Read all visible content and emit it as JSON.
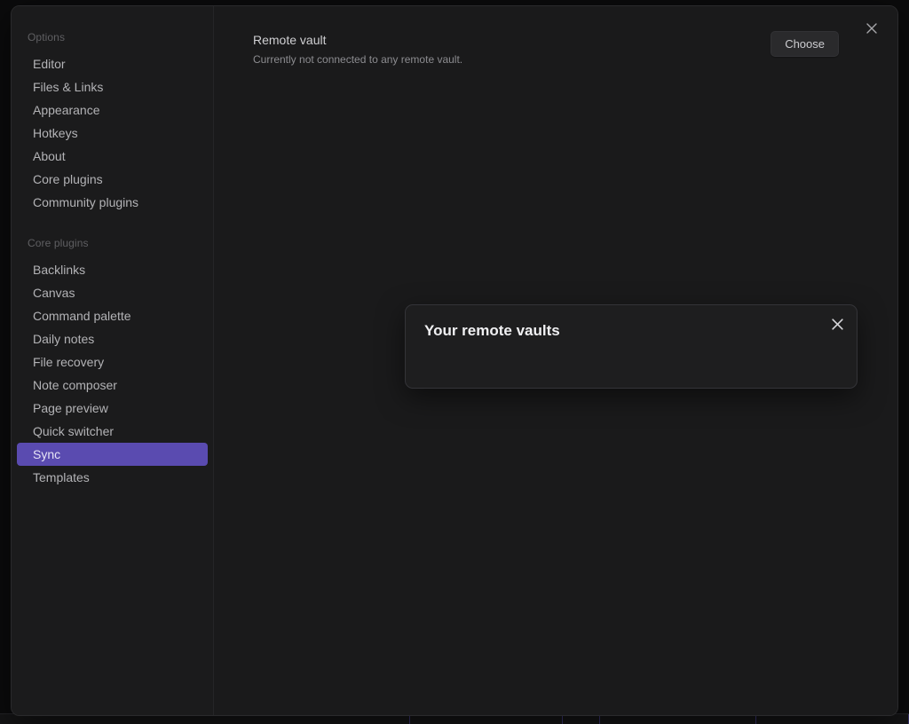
{
  "window": {
    "close_icon": "close-icon"
  },
  "sidebar": {
    "groups": [
      {
        "header": "Options",
        "items": [
          {
            "label": "Editor",
            "active": false
          },
          {
            "label": "Files & Links",
            "active": false
          },
          {
            "label": "Appearance",
            "active": false
          },
          {
            "label": "Hotkeys",
            "active": false
          },
          {
            "label": "About",
            "active": false
          },
          {
            "label": "Core plugins",
            "active": false
          },
          {
            "label": "Community plugins",
            "active": false
          }
        ]
      },
      {
        "header": "Core plugins",
        "items": [
          {
            "label": "Backlinks",
            "active": false
          },
          {
            "label": "Canvas",
            "active": false
          },
          {
            "label": "Command palette",
            "active": false
          },
          {
            "label": "Daily notes",
            "active": false
          },
          {
            "label": "File recovery",
            "active": false
          },
          {
            "label": "Note composer",
            "active": false
          },
          {
            "label": "Page preview",
            "active": false
          },
          {
            "label": "Quick switcher",
            "active": false
          },
          {
            "label": "Sync",
            "active": true
          },
          {
            "label": "Templates",
            "active": false
          }
        ]
      }
    ]
  },
  "main": {
    "setting": {
      "name": "Remote vault",
      "description": "Currently not connected to any remote vault.",
      "button_label": "Choose"
    }
  },
  "modal": {
    "title": "Your remote vaults",
    "close_icon": "close-icon"
  },
  "colors": {
    "accent": "#5a4bb0",
    "window_background": "#1a1a1b",
    "sidebar_background": "#1b1b1c",
    "modal_background": "#1e1e1f",
    "text_primary": "#cfcfd2",
    "text_muted": "#8c8c90",
    "status_divider": "#3b3570"
  }
}
